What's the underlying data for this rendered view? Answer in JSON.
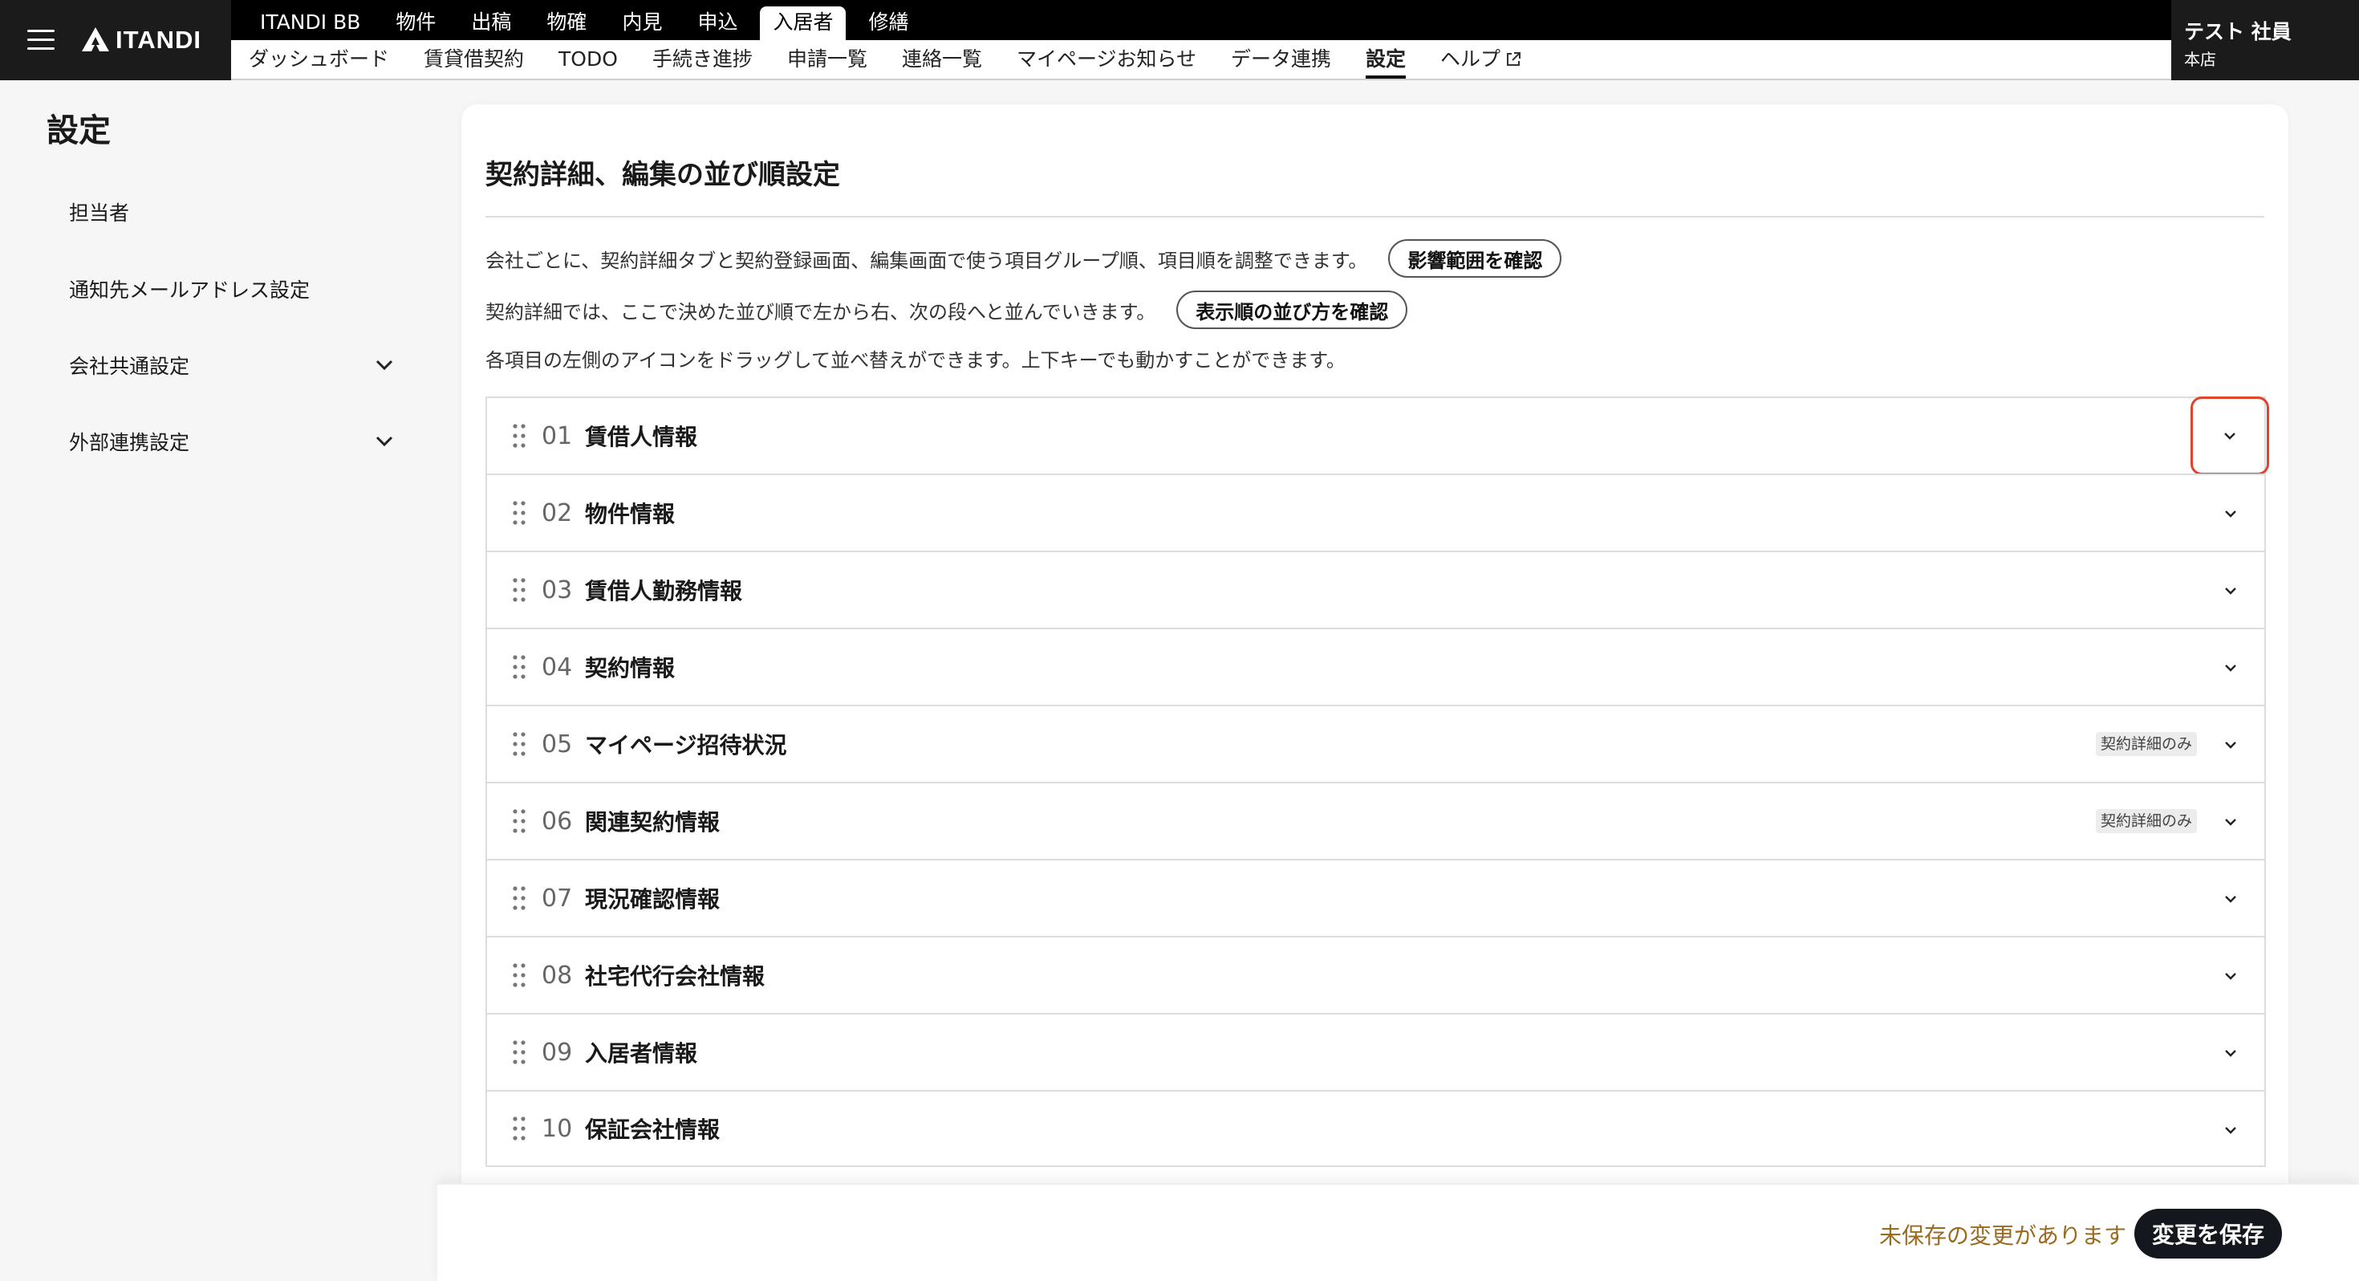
{
  "header": {
    "logo_text": "ITANDI",
    "primary_tabs": [
      "ITANDI BB",
      "物件",
      "出稿",
      "物確",
      "内見",
      "申込",
      "入居者",
      "修繕"
    ],
    "primary_active": "入居者",
    "secondary_tabs": [
      "ダッシュボード",
      "賃貸借契約",
      "TODO",
      "手続き進捗",
      "申請一覧",
      "連絡一覧",
      "マイページお知らせ",
      "データ連携",
      "設定",
      "ヘルプ"
    ],
    "secondary_active": "設定",
    "user_name": "テスト 社員",
    "user_store": "本店"
  },
  "sidebar": {
    "title": "設定",
    "items": [
      {
        "label": "担当者",
        "expandable": false
      },
      {
        "label": "通知先メールアドレス設定",
        "expandable": false
      },
      {
        "label": "会社共通設定",
        "expandable": true
      },
      {
        "label": "外部連携設定",
        "expandable": true
      }
    ]
  },
  "main": {
    "title": "契約詳細、編集の並び順設定",
    "desc1": "会社ごとに、契約詳細タブと契約登録画面、編集画面で使う項目グループ順、項目順を調整できます。",
    "desc1_button": "影響範囲を確認",
    "desc2": "契約詳細では、ここで決めた並び順で左から右、次の段へと並んでいきます。",
    "desc2_button": "表示順の並び方を確認",
    "desc3": "各項目の左側のアイコンをドラッグして並べ替えができます。上下キーでも動かすことができます。",
    "groups": [
      {
        "num": "01",
        "name": "賃借人情報",
        "badge": ""
      },
      {
        "num": "02",
        "name": "物件情報",
        "badge": ""
      },
      {
        "num": "03",
        "name": "賃借人勤務情報",
        "badge": ""
      },
      {
        "num": "04",
        "name": "契約情報",
        "badge": ""
      },
      {
        "num": "05",
        "name": "マイページ招待状況",
        "badge": "契約詳細のみ"
      },
      {
        "num": "06",
        "name": "関連契約情報",
        "badge": "契約詳細のみ"
      },
      {
        "num": "07",
        "name": "現況確認情報",
        "badge": ""
      },
      {
        "num": "08",
        "name": "社宅代行会社情報",
        "badge": ""
      },
      {
        "num": "09",
        "name": "入居者情報",
        "badge": ""
      },
      {
        "num": "10",
        "name": "保証会社情報",
        "badge": ""
      }
    ]
  },
  "footer": {
    "unsaved_text": "未保存の変更があります",
    "save_label": "変更を保存"
  }
}
